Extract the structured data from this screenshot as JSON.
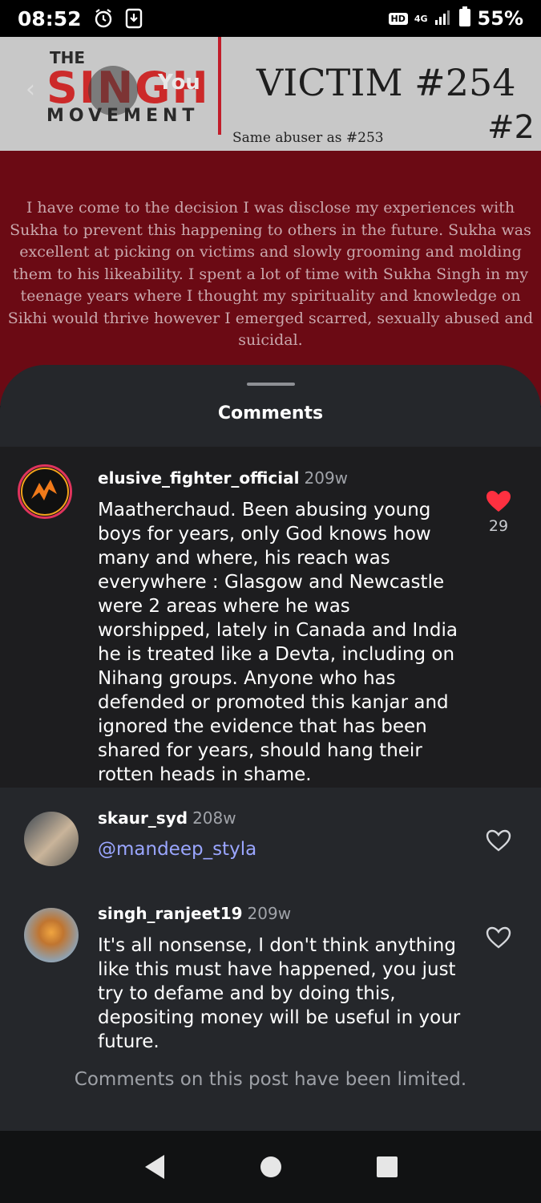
{
  "status_bar": {
    "time": "08:52",
    "hd_badge": "HD",
    "network": "4G",
    "battery": "55%"
  },
  "post": {
    "logo": {
      "the": "THE",
      "singh": "SINGH",
      "movement": "MOVEMENT",
      "overlay_text": "You"
    },
    "title": "VICTIM #254",
    "subtitle": "Same abuser as #253",
    "number": "#2",
    "body": "I have come to the decision I was disclose my experiences with Sukha to prevent this happening to others in the future. Sukha was excellent at picking on victims and slowly grooming and molding them to his likeability. I spent a lot of time with Sukha Singh in my teenage years where I thought my spirituality and knowledge on Sikhi would thrive however I emerged scarred, sexually abused and suicidal."
  },
  "comments_sheet": {
    "title": "Comments",
    "comments": [
      {
        "username": "elusive_fighter_official",
        "time": "209w",
        "text": "Maatherchaud.  Been abusing young boys for years, only God knows how many and where, his reach was everywhere : Glasgow and Newcastle were 2 areas where he was worshipped, lately in Canada and India he is treated like a Devta, including on Nihang groups.  Anyone who has defended or promoted this kanjar and ignored the evidence that has been shared for years, should hang their rotten heads in shame.",
        "likes": "29",
        "liked": true
      },
      {
        "username": "skaur_syd",
        "time": "208w",
        "text": "@mandeep_styla",
        "likes": "",
        "liked": false
      },
      {
        "username": "singh_ranjeet19",
        "time": "209w",
        "text": "It's all nonsense, I don't think anything like this must have happened, you just try to defame and by doing this, depositing money will be useful in your future.",
        "likes": "",
        "liked": false
      }
    ],
    "limited_notice": "Comments on this post have been limited."
  },
  "colors": {
    "post_red": "#6b0a14",
    "sheet_bg": "#25272b",
    "like_red": "#ff3040",
    "mention": "#9aa6ff"
  }
}
